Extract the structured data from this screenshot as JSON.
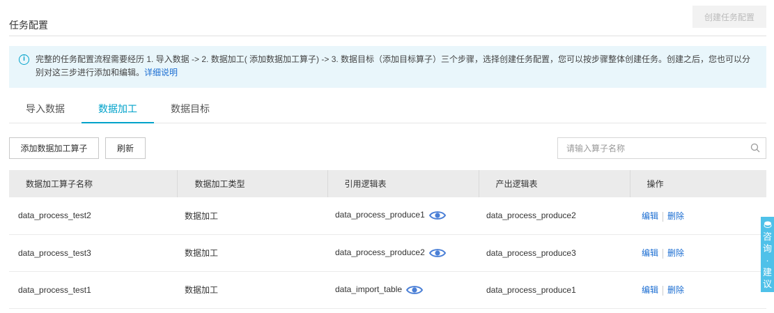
{
  "header": {
    "title": "任务配置",
    "create_button": "创建任务配置"
  },
  "notice": {
    "text": "完整的任务配置流程需要经历 1. 导入数据 -> 2. 数据加工( 添加数据加工算子) -> 3. 数据目标（添加目标算子）三个步骤，选择创建任务配置，您可以按步骤整体创建任务。创建之后，您也可以分别对这三步进行添加和编辑。",
    "link": "详细说明"
  },
  "tabs": [
    {
      "label": "导入数据"
    },
    {
      "label": "数据加工"
    },
    {
      "label": "数据目标"
    }
  ],
  "toolbar": {
    "add_button": "添加数据加工算子",
    "refresh_button": "刷新",
    "search_placeholder": "请输入算子名称"
  },
  "table": {
    "columns": [
      "数据加工算子名称",
      "数据加工类型",
      "引用逻辑表",
      "产出逻辑表",
      "操作"
    ],
    "rows": [
      {
        "name": "data_process_test2",
        "type": "数据加工",
        "ref": "data_process_produce1",
        "out": "data_process_produce2",
        "edit": "编辑",
        "delete": "删除"
      },
      {
        "name": "data_process_test3",
        "type": "数据加工",
        "ref": "data_process_produce2",
        "out": "data_process_produce3",
        "edit": "编辑",
        "delete": "删除"
      },
      {
        "name": "data_process_test1",
        "type": "数据加工",
        "ref": "data_import_table",
        "out": "data_process_produce1",
        "edit": "编辑",
        "delete": "删除"
      }
    ]
  },
  "float_widget": {
    "chars": [
      "咨",
      "询",
      "·",
      "建",
      "议"
    ]
  },
  "colors": {
    "accent": "#00a2ca",
    "link": "#1c6ed2",
    "notice_bg": "#e9f6fb",
    "eye": "#4a7fd6",
    "widget": "#4fc1e9"
  }
}
